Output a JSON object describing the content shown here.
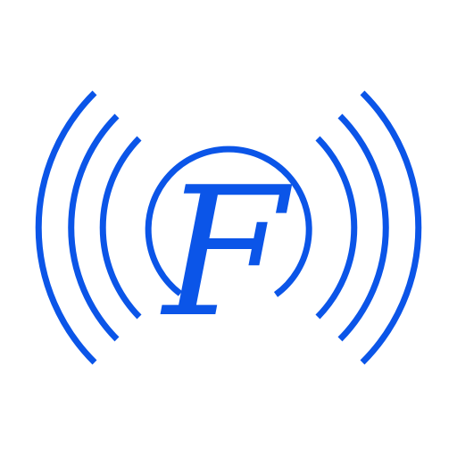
{
  "icon": {
    "name": "broadcast-f-logo",
    "letter": "F",
    "color": "#0b55e8",
    "background": "#ffffff"
  }
}
